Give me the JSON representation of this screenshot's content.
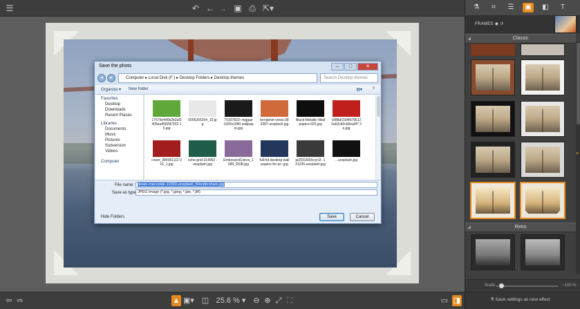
{
  "toolbar": {
    "icons": [
      "menu-icon",
      "undo-icon",
      "undo-small-icon",
      "redo-icon",
      "save-icon",
      "print-icon",
      "export-icon"
    ]
  },
  "dialog": {
    "title": "Save the photo",
    "address_path": "Computer ▸ Local Disk (F:) ▸ Desktop Folders ▸ Desktop themes",
    "search_placeholder": "Search Desktop themes",
    "organize": "Organize ▾",
    "new_folder": "New folder",
    "nav": {
      "favorites": "Favorites",
      "desktop": "Desktop",
      "downloads": "Downloads",
      "recent": "Recent Places",
      "libraries": "Libraries",
      "documents": "Documents",
      "music": "Music",
      "pictures": "Pictures",
      "subversion": "Subversion",
      "videos": "Videos",
      "computer": "Computer"
    },
    "files": [
      {
        "name": "17579e446b2b2af3405ea458287202 15.jpg",
        "color": "#5fa83a"
      },
      {
        "name": "0006266254_10.jpg",
        "color": "#e8e8e8"
      },
      {
        "name": "70337823--reggae 1920x1080 wallpaper.jpg",
        "color": "#1a1a1a"
      },
      {
        "name": "benjamin-voros-380387-unsplash.jpg",
        "color": "#d06a3a"
      },
      {
        "name": "Black-Metallic-Wallpapers-025.jpg",
        "color": "#0e0e0e"
      },
      {
        "name": "c5f8b623d4679612 2ab2cb0cb5ea9f7 2e.jpg",
        "color": "#c0201c"
      },
      {
        "name": "cover_284361112 016_1.jpg",
        "color": "#a21e1e"
      },
      {
        "name": "echo-grid-314052 -unsplash.jpg",
        "color": "#1f5c4a"
      },
      {
        "name": "EmbossedColors_1080_RGB.jpg",
        "color": "#8a6a9a"
      },
      {
        "name": "full-hd-desktop-wallpapers-for-pc-.jpg",
        "color": "#23375c"
      },
      {
        "name": "ja2031600ccycl3 -131226-unsplash.jpg",
        "color": "#3a3a3a"
      },
      {
        "name": "...unsplash.jpg",
        "color": "#111111"
      }
    ],
    "file_name_label": "File name:",
    "file_name_value": "dewin-meccolde-13393-unsplash_Wondershare.jpg",
    "save_type_label": "Save as type:",
    "save_type_value": "JPEG Image (*.jpg, *.jpeg, *.jpe, *.jfif)",
    "hide_folders": "Hide Folders",
    "save": "Save",
    "cancel": "Cancel"
  },
  "bottom": {
    "zoom": "25.6 %"
  },
  "panel": {
    "header": "FRAMES",
    "classic": "Classic",
    "retro": "Retro",
    "scale_label": "Scale",
    "scale_value": "100 %",
    "scale_fraction": 0.05,
    "save_effect": "Save settings as new effect"
  },
  "colors": {
    "accent": "#e68a1f"
  }
}
